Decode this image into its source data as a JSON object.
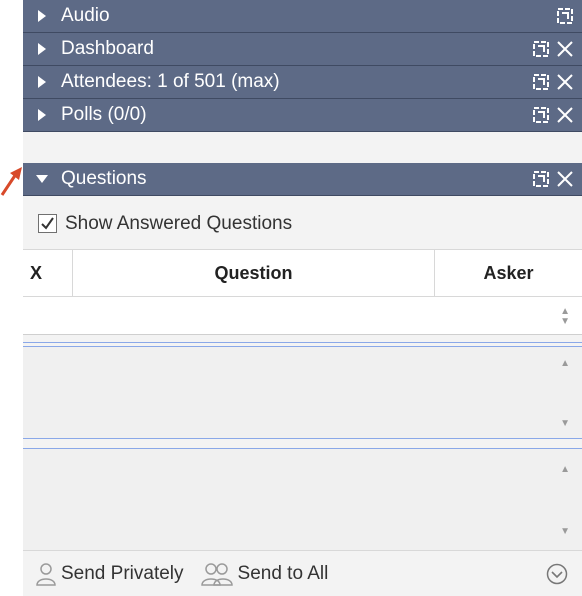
{
  "panes": [
    {
      "title": "Audio",
      "expanded": false,
      "has_close": false
    },
    {
      "title": "Dashboard",
      "expanded": false,
      "has_close": true
    },
    {
      "title": "Attendees: 1 of 501 (max)",
      "expanded": false,
      "has_close": true
    },
    {
      "title": "Polls (0/0)",
      "expanded": false,
      "has_close": true
    },
    {
      "title": "Questions",
      "expanded": true,
      "has_close": true
    }
  ],
  "questions": {
    "show_answered_label": "Show Answered Questions",
    "show_answered_checked": true,
    "columns": [
      "X",
      "Question",
      "Asker"
    ],
    "send_privately_label": "Send Privately",
    "send_to_all_label": "Send to All"
  },
  "colors": {
    "header_bg": "#5d6a86",
    "panel_bg": "#f3f3f3",
    "annotation_arrow": "#d84a2a"
  }
}
